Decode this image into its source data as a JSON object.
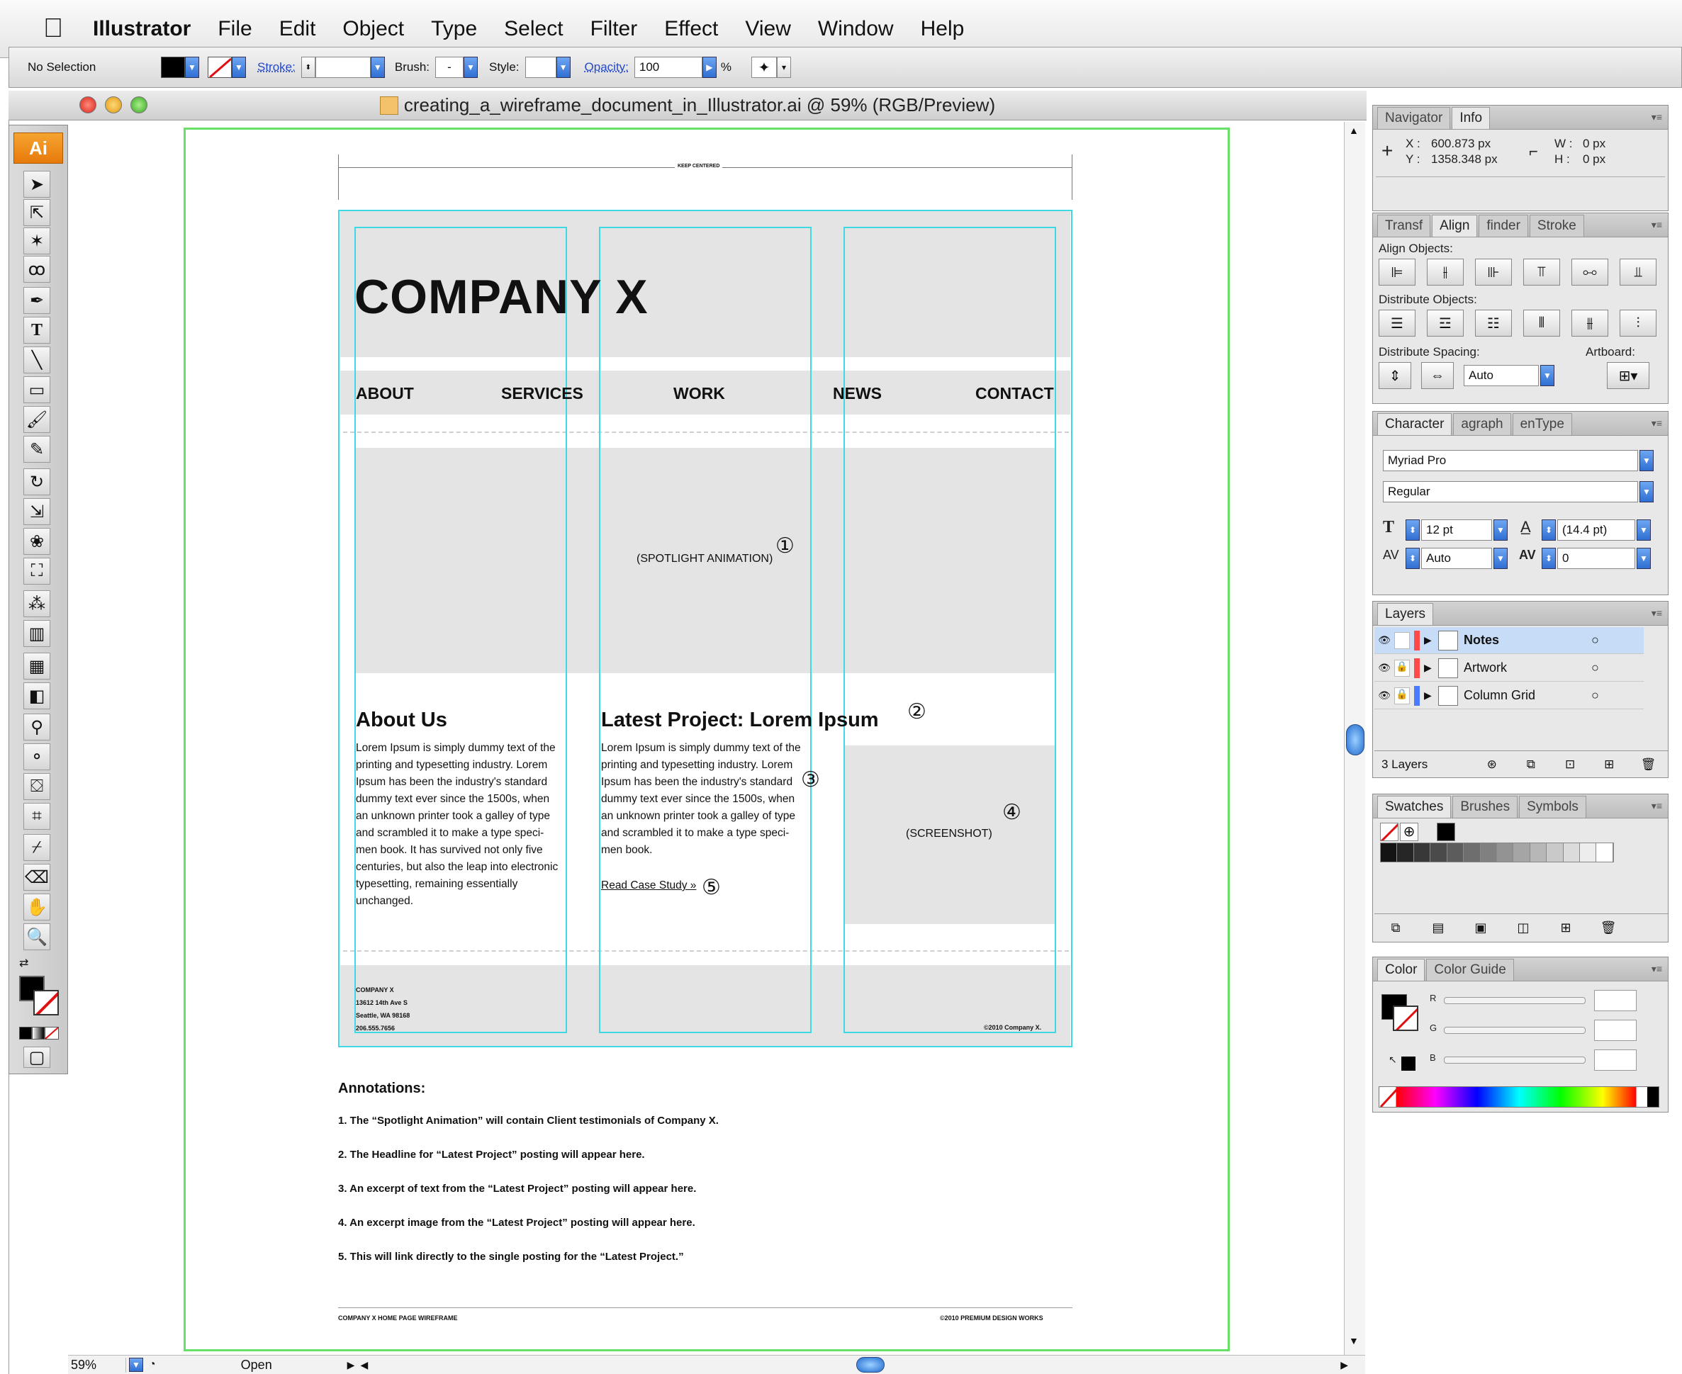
{
  "menubar": {
    "app": "Illustrator",
    "items": [
      "File",
      "Edit",
      "Object",
      "Type",
      "Select",
      "Filter",
      "Effect",
      "View",
      "Window",
      "Help"
    ]
  },
  "control_bar": {
    "selection": "No Selection",
    "stroke_label": "Stroke:",
    "brush_label": "Brush:",
    "brush_value": "-",
    "style_label": "Style:",
    "opacity_label": "Opacity:",
    "opacity_value": "100",
    "percent": "%"
  },
  "document": {
    "title": "creating_a_wireframe_document_in_Illustrator.ai @ 59% (RGB/Preview)",
    "zoom": "59%",
    "status": "Open"
  },
  "tools": {
    "badge": "Ai"
  },
  "wireframe": {
    "center_label": "KEEP CENTERED",
    "company": "COMPANY X",
    "nav": [
      "ABOUT",
      "SERVICES",
      "WORK",
      "NEWS",
      "CONTACT"
    ],
    "spotlight": "(SPOTLIGHT ANIMATION)",
    "about_heading": "About Us",
    "about_text": "Lorem Ipsum is simply dummy text of the\nprinting and typesetting industry. Lorem\nIpsum has been the industry's standard\ndummy text ever since the 1500s, when\nan unknown printer took a galley of type\nand scrambled it to make a type speci-\nmen book. It has survived not only five\ncenturies, but also the leap into electronic\ntypesetting, remaining essentially\nunchanged.",
    "project_heading": "Latest Project: Lorem Ipsum",
    "project_text": "Lorem Ipsum is simply dummy text of the\nprinting and typesetting industry. Lorem\nIpsum has been the industry's standard\ndummy text ever since the 1500s, when\nan unknown printer took a galley of type\nand scrambled it to make a type speci-\nmen book.",
    "read_more": "Read Case Study »",
    "screenshot": "(SCREENSHOT)",
    "markers": [
      "①",
      "②",
      "③",
      "④",
      "⑤"
    ],
    "footer_address": "COMPANY X\n13612 14th Ave S\nSeattle, WA 98168\n206.555.7656",
    "footer_copyright": "©2010 Company X.",
    "annotations_title": "Annotations:",
    "annotations": [
      "1. The “Spotlight Animation” will contain Client testimonials of Company X.",
      "2. The Headline for “Latest Project” posting will appear here.",
      "3. An excerpt of text from the “Latest Project” posting will appear here.",
      "4. An excerpt image from the “Latest Project” posting will appear here.",
      "5. This will link directly to the single posting for the “Latest Project.”"
    ],
    "page_footer_left": "COMPANY X HOME PAGE WIREFRAME",
    "page_footer_right": "©2010 PREMIUM DESIGN WORKS"
  },
  "panels": {
    "info": {
      "tabs": [
        "Navigator",
        "Info"
      ],
      "x_label": "X :",
      "x_value": "600.873 px",
      "y_label": "Y :",
      "y_value": "1358.348 px",
      "w_label": "W :",
      "w_value": "0 px",
      "h_label": "H :",
      "h_value": "0 px"
    },
    "align": {
      "tabs": [
        "Transf",
        "Align",
        "finder",
        "Stroke"
      ],
      "align_objects": "Align Objects:",
      "distribute_objects": "Distribute Objects:",
      "distribute_spacing": "Distribute Spacing:",
      "artboard": "Artboard:",
      "spacing_value": "Auto"
    },
    "character": {
      "tabs": [
        "Character",
        "agraph",
        "enType"
      ],
      "font": "Myriad Pro",
      "style": "Regular",
      "size": "12 pt",
      "leading": "(14.4 pt)",
      "kerning": "Auto",
      "tracking": "0"
    },
    "layers": {
      "tabs": [
        "Layers"
      ],
      "items": [
        {
          "name": "Notes",
          "color": "#ff4a4a"
        },
        {
          "name": "Artwork",
          "color": "#ff4a4a"
        },
        {
          "name": "Column Grid",
          "color": "#4a7bff"
        }
      ],
      "count": "3 Layers"
    },
    "swatches": {
      "tabs": [
        "Swatches",
        "Brushes",
        "Symbols"
      ]
    },
    "color": {
      "tabs": [
        "Color",
        "Color Guide"
      ],
      "r": "R",
      "g": "G",
      "b": "B"
    }
  },
  "colors": {
    "guide": "#3fd9e6",
    "artboard": "#66e066",
    "block_gray": "#e4e4e4",
    "ai_orange": "#e77a0b"
  }
}
